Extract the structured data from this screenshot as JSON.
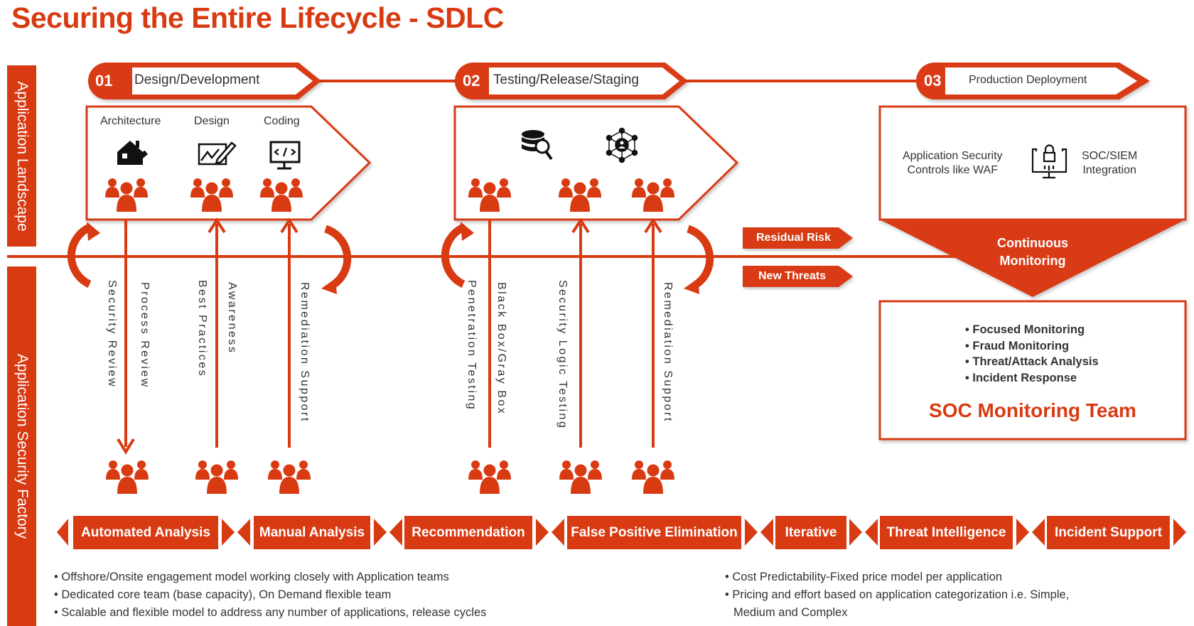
{
  "title": "Securing the Entire Lifecycle - SDLC",
  "colors": {
    "accent": "#d83a12",
    "text": "#333333"
  },
  "sidebar": {
    "top_label": "Application Landscape",
    "bottom_label": "Application Security Factory"
  },
  "stages": [
    {
      "number": "01",
      "label": "Design/Development"
    },
    {
      "number": "02",
      "label": "Testing/Release/Staging"
    },
    {
      "number": "03",
      "label": "Production Deployment"
    }
  ],
  "stage1": {
    "columns": [
      {
        "label": "Architecture",
        "icon": "house-ruler-icon"
      },
      {
        "label": "Design",
        "icon": "chart-pencil-icon"
      },
      {
        "label": "Coding",
        "icon": "monitor-code-icon"
      }
    ],
    "activities": [
      "Security Review",
      "Process Review",
      "Best Practices",
      "Awareness",
      "Remediation Support"
    ]
  },
  "stage2": {
    "icons": [
      "database-search-icon",
      "network-user-icon"
    ],
    "activities": [
      "Penetration Testing",
      "Black Box/Gray Box",
      "Security Logic Testing",
      "Remediation Support"
    ]
  },
  "stage3": {
    "left_text": [
      "Application Security",
      "Controls like WAF"
    ],
    "icon": "monitor-lock-icon",
    "right_text": [
      "SOC/SIEM",
      "Integration"
    ],
    "monitoring_label": [
      "Continuous",
      "Monitoring"
    ],
    "soc_items": [
      "Focused Monitoring",
      "Fraud Monitoring",
      "Threat/Attack Analysis",
      "Incident Response"
    ],
    "soc_title": "SOC Monitoring Team"
  },
  "tags": [
    "Residual Risk",
    "New Threats"
  ],
  "services": [
    "Automated Analysis",
    "Manual Analysis",
    "Recommendation",
    "False Positive Elimination",
    "Iterative",
    "Threat Intelligence",
    "Incident Support"
  ],
  "notes_left": [
    "Offshore/Onsite engagement model working closely with Application teams",
    "Dedicated core team (base capacity), On Demand flexible team",
    "Scalable and flexible model to address any number of applications, release cycles"
  ],
  "notes_right": [
    "Cost Predictability-Fixed price model per application",
    "Pricing and effort based on application categorization i.e. Simple,",
    "Medium and Complex"
  ]
}
